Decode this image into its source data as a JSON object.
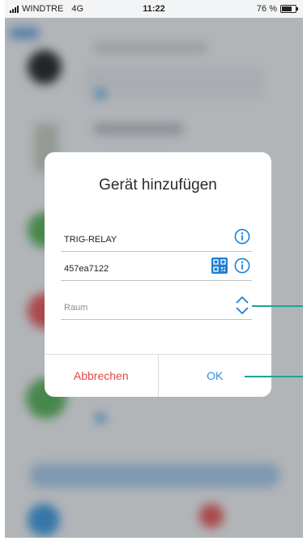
{
  "status_bar": {
    "carrier": "WINDTRE",
    "network": "4G",
    "time": "11:22",
    "battery": "76 %",
    "battery_level": 0.76
  },
  "dialog": {
    "title": "Gerät hinzufügen",
    "fields": {
      "name_value": "TRIG-RELAY",
      "id_value": "457ea7122",
      "room_placeholder": "Raum"
    },
    "buttons": {
      "cancel": "Abbrechen",
      "ok": "OK"
    }
  },
  "colors": {
    "accent_blue": "#1f7fd4",
    "cancel_red": "#e04a44",
    "callout_teal": "#1aa39a"
  },
  "icons": [
    "signal-icon",
    "battery-icon",
    "info-icon",
    "qr-code-icon",
    "up-down-chevron-icon"
  ]
}
